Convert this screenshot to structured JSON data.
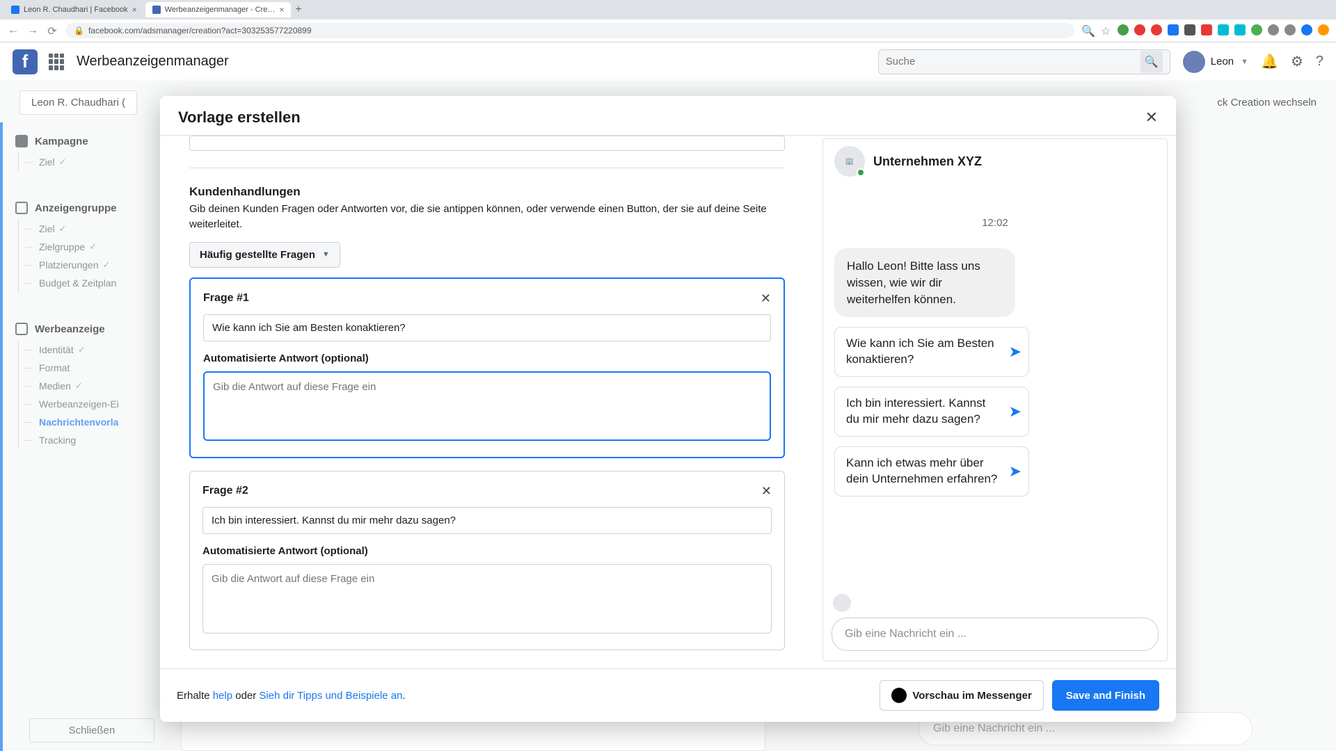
{
  "browser": {
    "tab1": "Leon R. Chaudhari | Facebook",
    "tab2": "Werbeanzeigenmanager - Cre…",
    "url": "facebook.com/adsmanager/creation?act=303253577220899"
  },
  "topbar": {
    "app_title": "Werbeanzeigenmanager",
    "search_placeholder": "Suche",
    "user_name": "Leon"
  },
  "bg": {
    "left_chip": "Leon R. Chaudhari (",
    "right_chip": "ck Creation wechseln",
    "close_btn": "Schließen",
    "preview_input": "Gib eine Nachricht ein ...",
    "nav": {
      "section1": "Kampagne",
      "s1_items": [
        "Ziel"
      ],
      "section2": "Anzeigengruppe",
      "s2_items": [
        "Ziel",
        "Zielgruppe",
        "Platzierungen",
        "Budget & Zeitplan"
      ],
      "section3": "Werbeanzeige",
      "s3_items": [
        "Identität",
        "Format",
        "Medien",
        "Werbeanzeigen-Ei",
        "Nachrichtenvorla",
        "Tracking"
      ]
    }
  },
  "modal": {
    "title": "Vorlage erstellen",
    "section_title": "Kundenhandlungen",
    "section_desc": "Gib deinen Kunden Fragen oder Antworten vor, die sie antippen können, oder verwende einen Button, der sie auf deine Seite weiterleitet.",
    "dropdown_label": "Häufig gestellte Fragen",
    "q1": {
      "title": "Frage #1",
      "value": "Wie kann ich Sie am Besten konaktieren?",
      "ans_label": "Automatisierte Antwort (optional)",
      "ans_placeholder": "Gib die Antwort auf diese Frage ein"
    },
    "q2": {
      "title": "Frage #2",
      "value": "Ich bin interessiert. Kannst du mir mehr dazu sagen?",
      "ans_label": "Automatisierte Antwort (optional)",
      "ans_placeholder": "Gib die Antwort auf diese Frage ein"
    },
    "preview": {
      "page_name": "Unternehmen XYZ",
      "time": "12:02",
      "greeting": "Hallo Leon! Bitte lass uns wissen, wie wir dir weiterhelfen können.",
      "qr1": "Wie kann ich Sie am Besten konaktieren?",
      "qr2": "Ich bin interessiert. Kannst du mir mehr dazu sagen?",
      "qr3": "Kann ich etwas mehr über dein Unternehmen erfahren?",
      "input_placeholder": "Gib eine Nachricht ein ..."
    },
    "footer": {
      "prefix": "Erhalte ",
      "help": "help",
      "mid": " oder ",
      "tips": "Sieh dir Tipps und Beispiele an",
      "suffix": ".",
      "preview_btn": "Vorschau im Messenger",
      "save_btn": "Save and Finish"
    }
  }
}
